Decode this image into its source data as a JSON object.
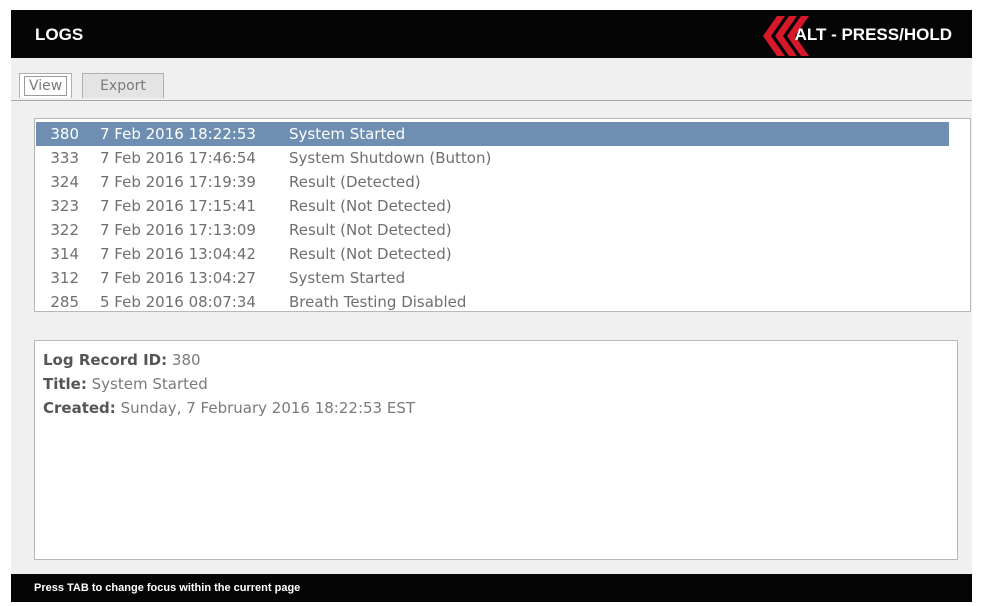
{
  "header": {
    "title": "LOGS",
    "logo": "red-chevrons-logo",
    "alt_label": "ALT - PRESS/HOLD",
    "accent_color": "#d6182a"
  },
  "tabs": [
    {
      "label": "View",
      "active": true
    },
    {
      "label": "Export",
      "active": false
    }
  ],
  "log_list": {
    "rows": [
      {
        "id": "380",
        "date": "7 Feb 2016 18:22:53",
        "title": "System Started",
        "selected": true
      },
      {
        "id": "333",
        "date": "7 Feb 2016 17:46:54",
        "title": "System Shutdown (Button)"
      },
      {
        "id": "324",
        "date": "7 Feb 2016 17:19:39",
        "title": "Result (Detected)"
      },
      {
        "id": "323",
        "date": "7 Feb 2016 17:15:41",
        "title": "Result (Not Detected)"
      },
      {
        "id": "322",
        "date": "7 Feb 2016 17:13:09",
        "title": "Result (Not Detected)"
      },
      {
        "id": "314",
        "date": "7 Feb 2016 13:04:42",
        "title": "Result (Not Detected)"
      },
      {
        "id": "312",
        "date": "7 Feb 2016 13:04:27",
        "title": "System Started"
      },
      {
        "id": "285",
        "date": "5 Feb 2016 08:07:34",
        "title": "Breath Testing Disabled"
      }
    ],
    "selection_color": "#6e8fb2"
  },
  "detail": {
    "record_id_label": "Log Record ID:",
    "record_id": "380",
    "title_label": "Title:",
    "title": "System Started",
    "created_label": "Created:",
    "created": "Sunday, 7 February 2016 18:22:53 EST"
  },
  "footer": {
    "hint": "Press TAB to change focus within the current page"
  }
}
